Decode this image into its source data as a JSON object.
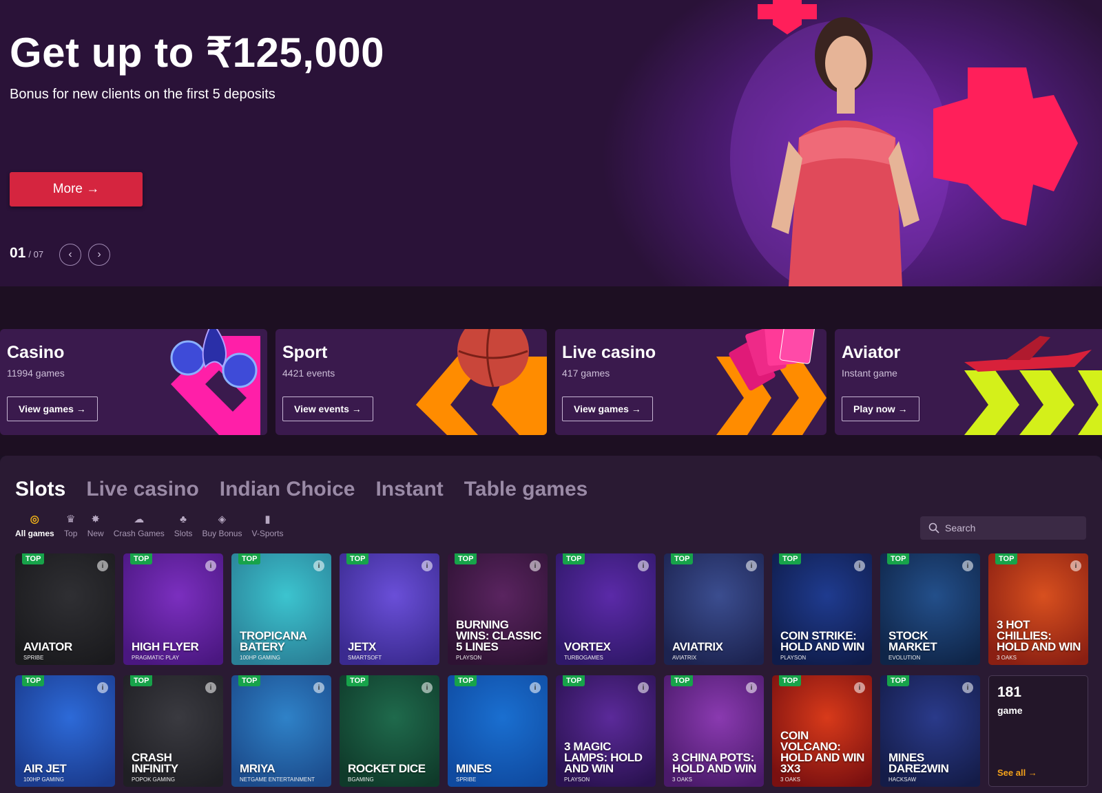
{
  "hero": {
    "title": "Get up to ₹125,000",
    "subtitle": "Bonus for new clients on the first 5 deposits",
    "button": "More →",
    "slide_current": "01",
    "slide_total": "/ 07",
    "prev": "‹",
    "next": "›",
    "accent_color": "#ff1f5a"
  },
  "categories": [
    {
      "name": "Casino",
      "sub": "11994 games",
      "button": "View games →"
    },
    {
      "name": "Sport",
      "sub": "4421 events",
      "button": "View events →"
    },
    {
      "name": "Live casino",
      "sub": "417 games",
      "button": "View games →"
    },
    {
      "name": "Aviator",
      "sub": "Instant game",
      "button": "Play now →"
    }
  ],
  "games_section": {
    "tabs": [
      "Slots",
      "Live casino",
      "Indian Choice",
      "Instant",
      "Table games"
    ],
    "filters": [
      {
        "label": "All games",
        "icon": "compass-icon"
      },
      {
        "label": "Top",
        "icon": "crown-icon"
      },
      {
        "label": "New",
        "icon": "new-badge-icon"
      },
      {
        "label": "Crash Games",
        "icon": "explosion-icon"
      },
      {
        "label": "Slots",
        "icon": "cherry-icon"
      },
      {
        "label": "Buy Bonus",
        "icon": "money-bag-icon"
      },
      {
        "label": "V-Sports",
        "icon": "tablet-icon"
      }
    ],
    "search_placeholder": "Search",
    "badge": "TOP",
    "info": "i",
    "games": [
      {
        "name": "Aviator",
        "provider": "Spribe",
        "bg": "#2f2f33",
        "bg2": "#1a1a1d"
      },
      {
        "name": "High Flyer",
        "provider": "Pragmatic Play",
        "bg": "#7b2fbf",
        "bg2": "#4a1780"
      },
      {
        "name": "Tropicana Batery",
        "provider": "100HP Gaming",
        "bg": "#3cc4cf",
        "bg2": "#2a7f96"
      },
      {
        "name": "JetX",
        "provider": "SmartSoft",
        "bg": "#6a4fd8",
        "bg2": "#3a2a8f"
      },
      {
        "name": "Burning Wins: classic 5 lines",
        "provider": "Playson",
        "bg": "#5a2460",
        "bg2": "#2e1233"
      },
      {
        "name": "Vortex",
        "provider": "TurboGames",
        "bg": "#5b2aa8",
        "bg2": "#2f1868"
      },
      {
        "name": "Aviatrix",
        "provider": "Aviatrix",
        "bg": "#3b4d8f",
        "bg2": "#1c2350"
      },
      {
        "name": "Coin Strike: Hold and Win",
        "provider": "Playson",
        "bg": "#1f3b8f",
        "bg2": "#0f1c4a"
      },
      {
        "name": "Stock Market",
        "provider": "Evolution",
        "bg": "#234f8a",
        "bg2": "#0f2548"
      },
      {
        "name": "3 Hot Chillies: Hold and Win",
        "provider": "3 Oaks",
        "bg": "#d8501f",
        "bg2": "#8a1f12"
      },
      {
        "name": "Air Jet",
        "provider": "100HP Gaming",
        "bg": "#2d6ad8",
        "bg2": "#1a3a8c"
      },
      {
        "name": "Crash Infinity",
        "provider": "Popok Gaming",
        "bg": "#3a3a40",
        "bg2": "#1f1f24"
      },
      {
        "name": "Mriya",
        "provider": "Netgame Entertainment",
        "bg": "#2f82c8",
        "bg2": "#1b4a8a"
      },
      {
        "name": "Rocket Dice",
        "provider": "BGaming",
        "bg": "#1f6a4c",
        "bg2": "#0f3a2a"
      },
      {
        "name": "Mines",
        "provider": "Spribe",
        "bg": "#1a6fd0",
        "bg2": "#0f4aa0"
      },
      {
        "name": "3 Magic Lamps: Hold and Win",
        "provider": "Playson",
        "bg": "#5b2a9a",
        "bg2": "#2a1250"
      },
      {
        "name": "3 China Pots: Hold and Win",
        "provider": "3 Oaks",
        "bg": "#8a3ab0",
        "bg2": "#4a1a6a"
      },
      {
        "name": "Coin Volcano: Hold and Win 3x3",
        "provider": "3 Oaks",
        "bg": "#d83a1a",
        "bg2": "#7a1010"
      },
      {
        "name": "Mines Dare2Win",
        "provider": "Hacksaw",
        "bg": "#2a3a8a",
        "bg2": "#141c48"
      }
    ],
    "more": {
      "count": "181",
      "label": "game",
      "link": "See all →"
    }
  }
}
